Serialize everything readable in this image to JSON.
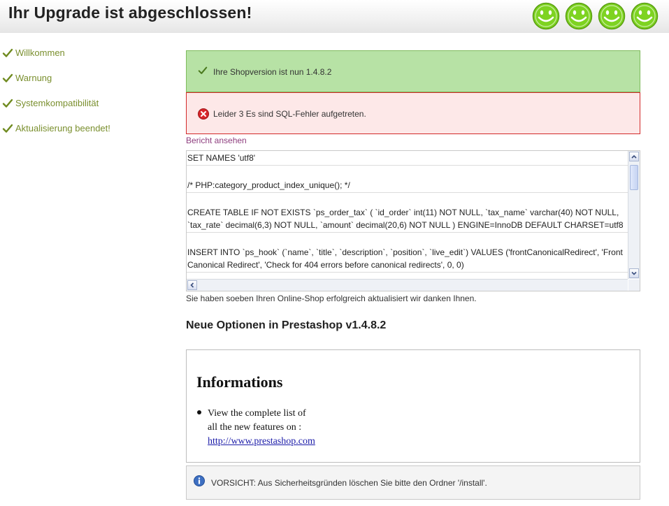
{
  "header": {
    "title": "Ihr Upgrade ist abgeschlossen!",
    "smiley_icons": [
      "smiley-icon",
      "smiley-icon",
      "smiley-icon",
      "smiley-icon"
    ]
  },
  "sidebar": {
    "steps": [
      {
        "label": "Willkommen",
        "icon": "checkmark-icon"
      },
      {
        "label": "Warnung",
        "icon": "checkmark-icon"
      },
      {
        "label": "Systemkompatibilität",
        "icon": "checkmark-icon"
      },
      {
        "label": "Aktualisierung beendet!",
        "icon": "checkmark-icon"
      }
    ]
  },
  "success_message": "Ihre Shopversion ist nun 1.4.8.2",
  "error_message": "Leider 3 Es sind SQL-Fehler aufgetreten.",
  "report_link": "Bericht ansehen",
  "sql_log": [
    "SET NAMES 'utf8'",
    "/* PHP:category_product_index_unique(); */",
    "CREATE TABLE IF NOT EXISTS `ps_order_tax` ( `id_order` int(11) NOT NULL, `tax_name` varchar(40) NOT NULL, `tax_rate` decimal(6,3) NOT NULL, `amount` decimal(20,6) NOT NULL ) ENGINE=InnoDB DEFAULT CHARSET=utf8",
    "INSERT INTO `ps_hook` (`name`, `title`, `description`, `position`, `live_edit`) VALUES ('frontCanonicalRedirect', 'Front Canonical Redirect', 'Check for 404 errors before canonical redirects', 0, 0)"
  ],
  "thanks_text": "Sie haben soeben Ihren Online-Shop erfolgreich aktualisiert wir danken Ihnen.",
  "new_options_heading": "Neue Optionen in Prestashop v1.4.8.2",
  "info": {
    "heading": "Informations",
    "bullet_line1": "View the complete list of",
    "bullet_line2": "all the new features on :",
    "link": "http://www.prestashop.com"
  },
  "warning_text": "VORSICHT: Aus Sicherheitsgründen löschen Sie bitte den Ordner '/install'.",
  "colors": {
    "success_bg": "#b7e2a5",
    "error_bg": "#fde8e8",
    "error_border": "#d22a2a",
    "step_text": "#7a8f2e",
    "link": "#8e3e7e",
    "smiley": "#7ed321"
  }
}
